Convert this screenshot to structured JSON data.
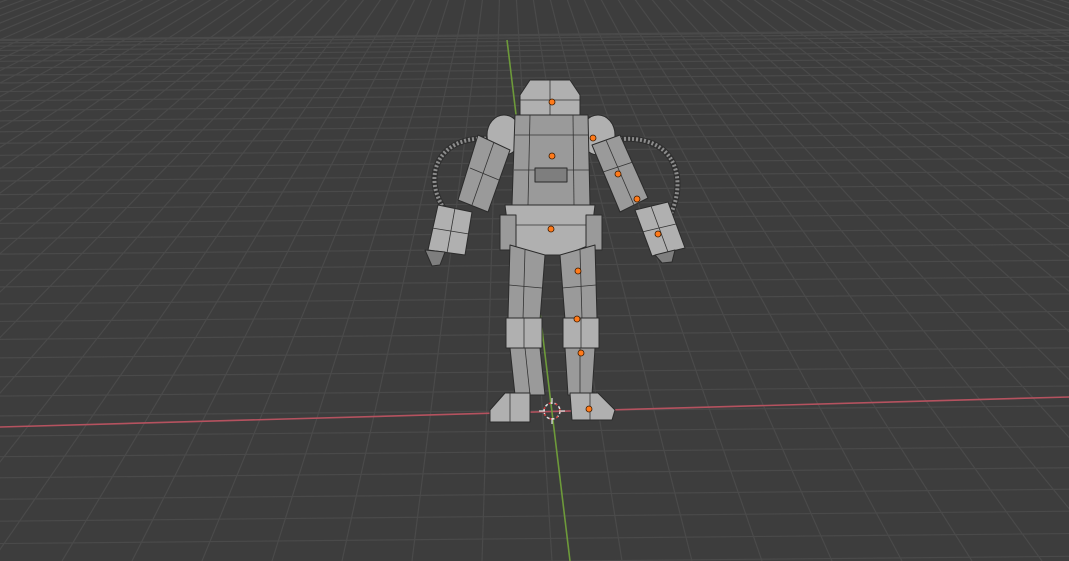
{
  "viewport": {
    "background_color": "#3d3d3d",
    "grid_color": "#4a4a4a",
    "x_axis_color": "#b5525f",
    "y_axis_color": "#6d9a3a",
    "mesh_color": "#9a9a9a",
    "origin_dot_color": "#ff7a1a"
  },
  "scene": {
    "object": "robot-mesh",
    "pivot_icon": "3d-cursor-icon"
  }
}
